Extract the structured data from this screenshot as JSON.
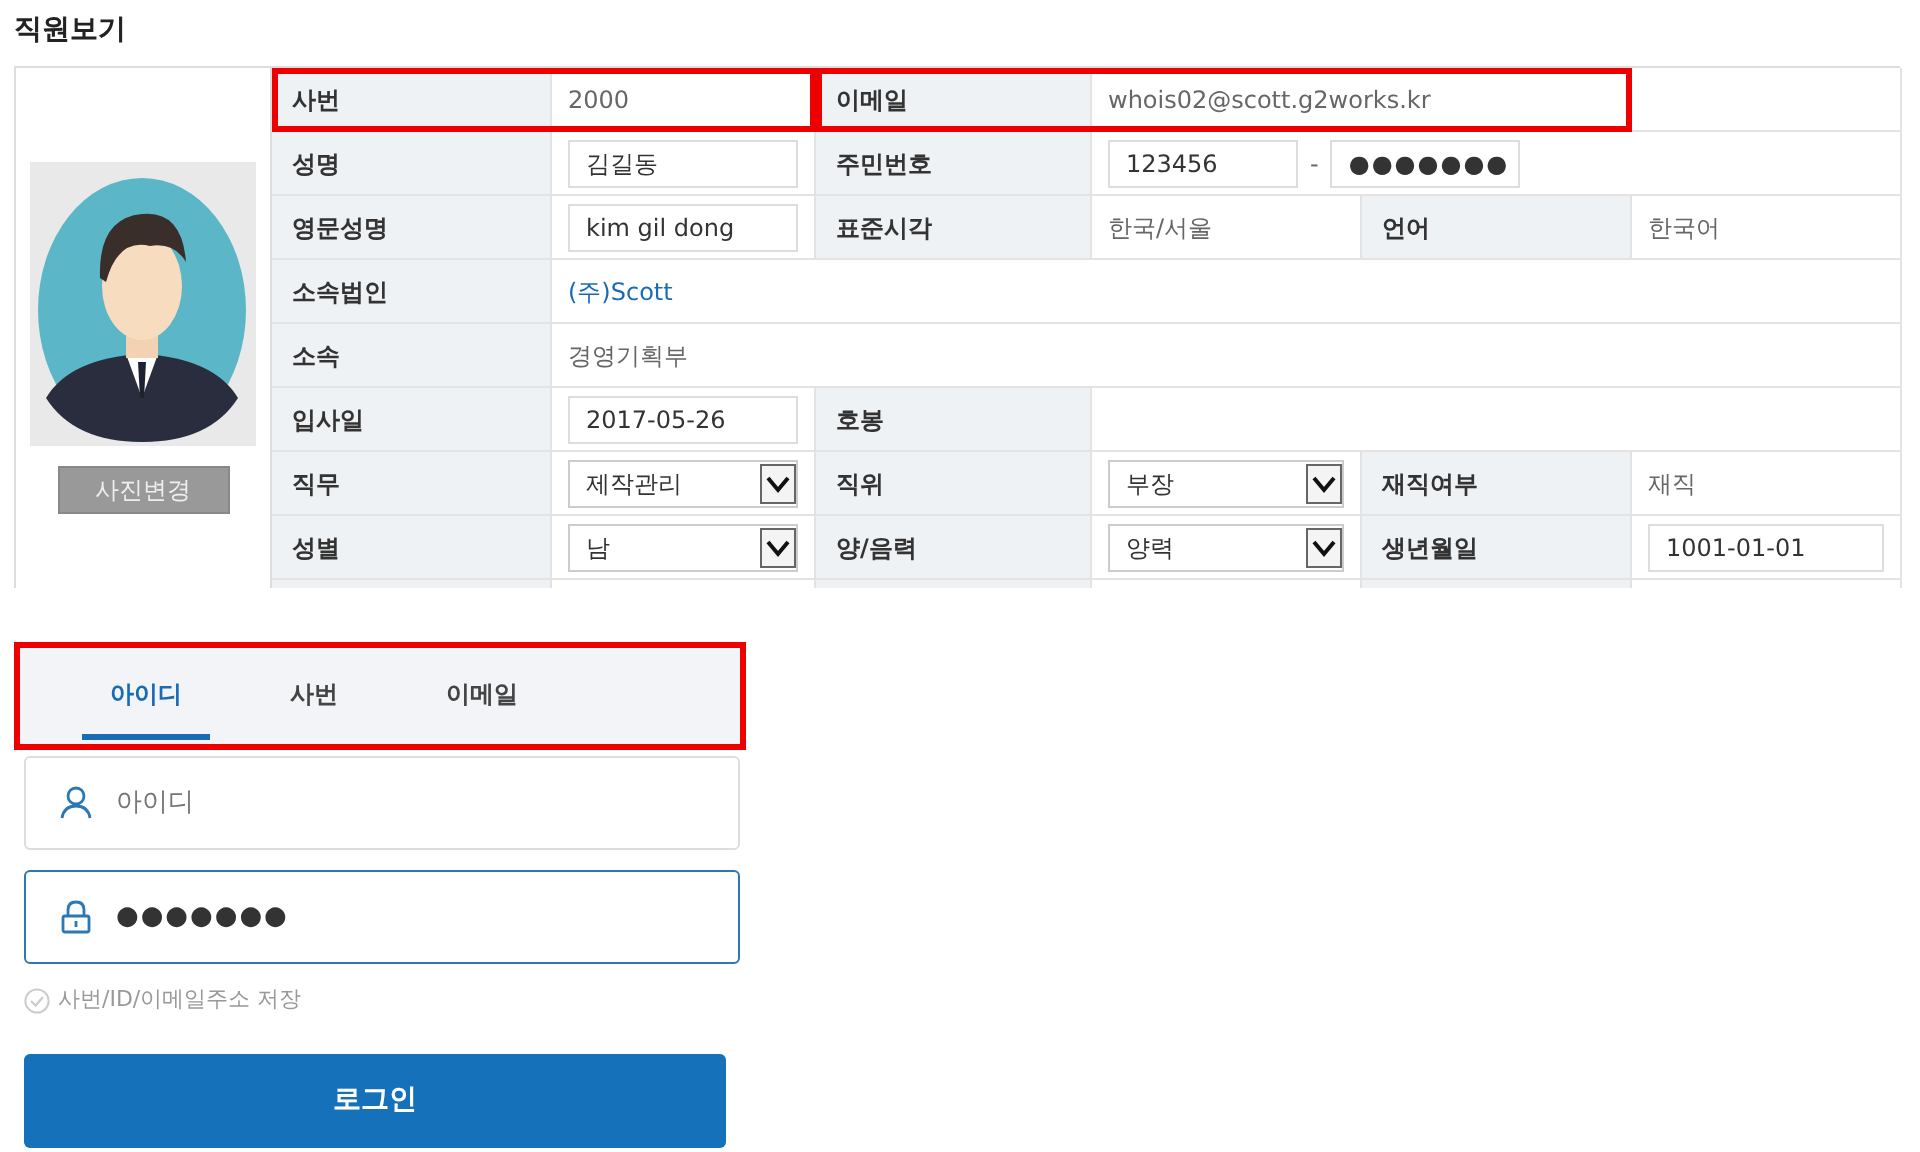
{
  "page_title": "직원보기",
  "photo": {
    "button": "사진변경"
  },
  "rows": [
    {
      "fields": [
        {
          "label": "사번",
          "kind": "text",
          "value": "2000",
          "highlighted": true
        },
        {
          "label": "이메일",
          "kind": "text",
          "value": "whois02@scott.g2works.kr",
          "highlighted": true
        }
      ]
    },
    {
      "fields": [
        {
          "label": "성명",
          "kind": "input",
          "value": "김길동",
          "highlighted": false
        },
        {
          "label": "주민번호",
          "kind": "pair",
          "value": "123456",
          "separator": "-",
          "value2": "●●●●●●●",
          "highlighted": false
        }
      ]
    },
    {
      "fields": [
        {
          "label": "영문성명",
          "kind": "input",
          "value": "kim gil dong",
          "highlighted": false
        },
        {
          "label": "표준시각",
          "kind": "text",
          "value": "한국/서울",
          "highlighted": false
        },
        {
          "label": "언어",
          "kind": "text",
          "value": "한국어",
          "highlighted": false
        }
      ]
    },
    {
      "fields": [
        {
          "label": "소속법인",
          "kind": "link",
          "value": "(주)Scott",
          "highlighted": false
        }
      ]
    },
    {
      "fields": [
        {
          "label": "소속",
          "kind": "text",
          "value": "경영기획부",
          "highlighted": false
        }
      ]
    },
    {
      "fields": [
        {
          "label": "입사일",
          "kind": "input",
          "value": "2017-05-26",
          "highlighted": false
        },
        {
          "label": "호봉",
          "kind": "text",
          "highlighted": false
        }
      ]
    },
    {
      "fields": [
        {
          "label": "직무",
          "kind": "select",
          "value": "제작관리",
          "highlighted": false
        },
        {
          "label": "직위",
          "kind": "select",
          "value": "부장",
          "highlighted": false
        },
        {
          "label": "재직여부",
          "kind": "text",
          "value": "재직",
          "highlighted": false
        }
      ]
    },
    {
      "fields": [
        {
          "label": "성별",
          "kind": "select",
          "value": "남",
          "highlighted": false
        },
        {
          "label": "양/음력",
          "kind": "select",
          "value": "양력",
          "highlighted": false
        },
        {
          "label": "생년월일",
          "kind": "input",
          "value": "1001-01-01",
          "highlighted": false
        }
      ]
    }
  ],
  "login": {
    "highlighted": true,
    "tabs": [
      {
        "label": "아이디",
        "selected": true
      },
      {
        "label": "사번",
        "selected": false
      },
      {
        "label": "이메일",
        "selected": false
      }
    ],
    "id_field": {
      "placeholder": "아이디",
      "focused": false
    },
    "password_field": {
      "value": "●●●●●●●",
      "focused": true
    },
    "remember": {
      "label": "사번/ID/이메일주소 저장",
      "checked": false
    },
    "button": "로그인"
  }
}
